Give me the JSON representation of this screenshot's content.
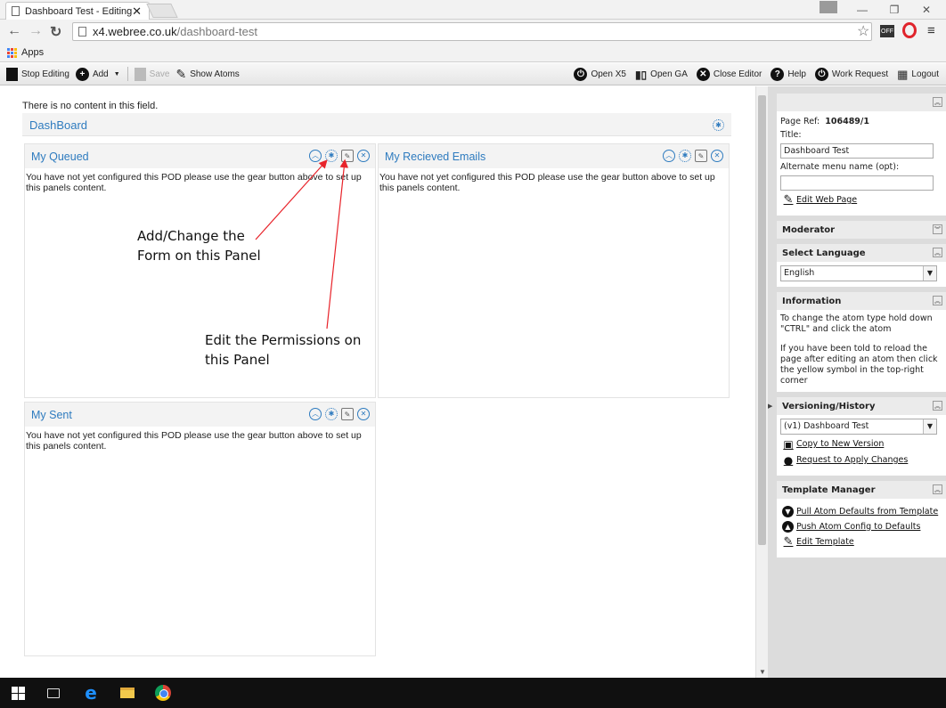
{
  "browser": {
    "tab_title": "Dashboard Test - Editing",
    "tab_close": "✕",
    "url_host": "x4.webree.co.uk",
    "url_path": "/dashboard-test",
    "bookmarks_apps": "Apps",
    "ext_badge": "OFF"
  },
  "toolbar": {
    "stop_editing": "Stop Editing",
    "add": "Add",
    "save": "Save",
    "show_atoms": "Show Atoms",
    "open_x5": "Open X5",
    "open_ga": "Open GA",
    "close_editor": "Close Editor",
    "help": "Help",
    "work_request": "Work Request",
    "logout": "Logout"
  },
  "main": {
    "no_content": "There is no content in this field.",
    "dashboard_title": "DashBoard",
    "pods": [
      {
        "title": "My Queued",
        "message": "You have not yet configured this POD please use the gear button above to set up this panels content."
      },
      {
        "title": "My Recieved Emails",
        "message": "You have not yet configured this POD please use the gear button above to set up this panels content."
      },
      {
        "title": "My Sent",
        "message": "You have not yet configured this POD please use the gear button above to set up this panels content."
      }
    ],
    "annotation_form_line1": "Add/Change the",
    "annotation_form_line2": "Form on this Panel",
    "annotation_perm_line1": "Edit the Permissions on",
    "annotation_perm_line2": "this Panel"
  },
  "sidebar": {
    "page_ref_label": "Page Ref:",
    "page_ref_value": "106489/1",
    "title_label": "Title:",
    "title_value": "Dashboard Test",
    "alt_menu_label": "Alternate menu name (opt):",
    "alt_menu_value": "",
    "edit_web_page": "Edit Web Page",
    "moderator_header": "Moderator",
    "language_header": "Select Language",
    "language_value": "English",
    "information_header": "Information",
    "info_text_1": "To change the atom type hold down \"CTRL\" and click the atom",
    "info_text_2": "If you have been told to reload the page after editing an atom then click the yellow symbol in the top-right corner",
    "versioning_header": "Versioning/History",
    "version_value": "(v1) Dashboard Test",
    "copy_version": "Copy to New Version",
    "request_changes": "Request to Apply Changes",
    "template_header": "Template Manager",
    "pull_defaults": "Pull Atom Defaults from Template",
    "push_config": "Push Atom Config to Defaults",
    "edit_template": "Edit Template"
  },
  "colors": {
    "accent_blue": "#2e7bbf",
    "annotation_arrow": "#e8232a"
  },
  "icons": {
    "pod_collapse": "chevron-up-circle-icon",
    "pod_config": "gear-icon",
    "pod_permissions": "permissions-icon",
    "pod_close": "close-circle-icon"
  }
}
